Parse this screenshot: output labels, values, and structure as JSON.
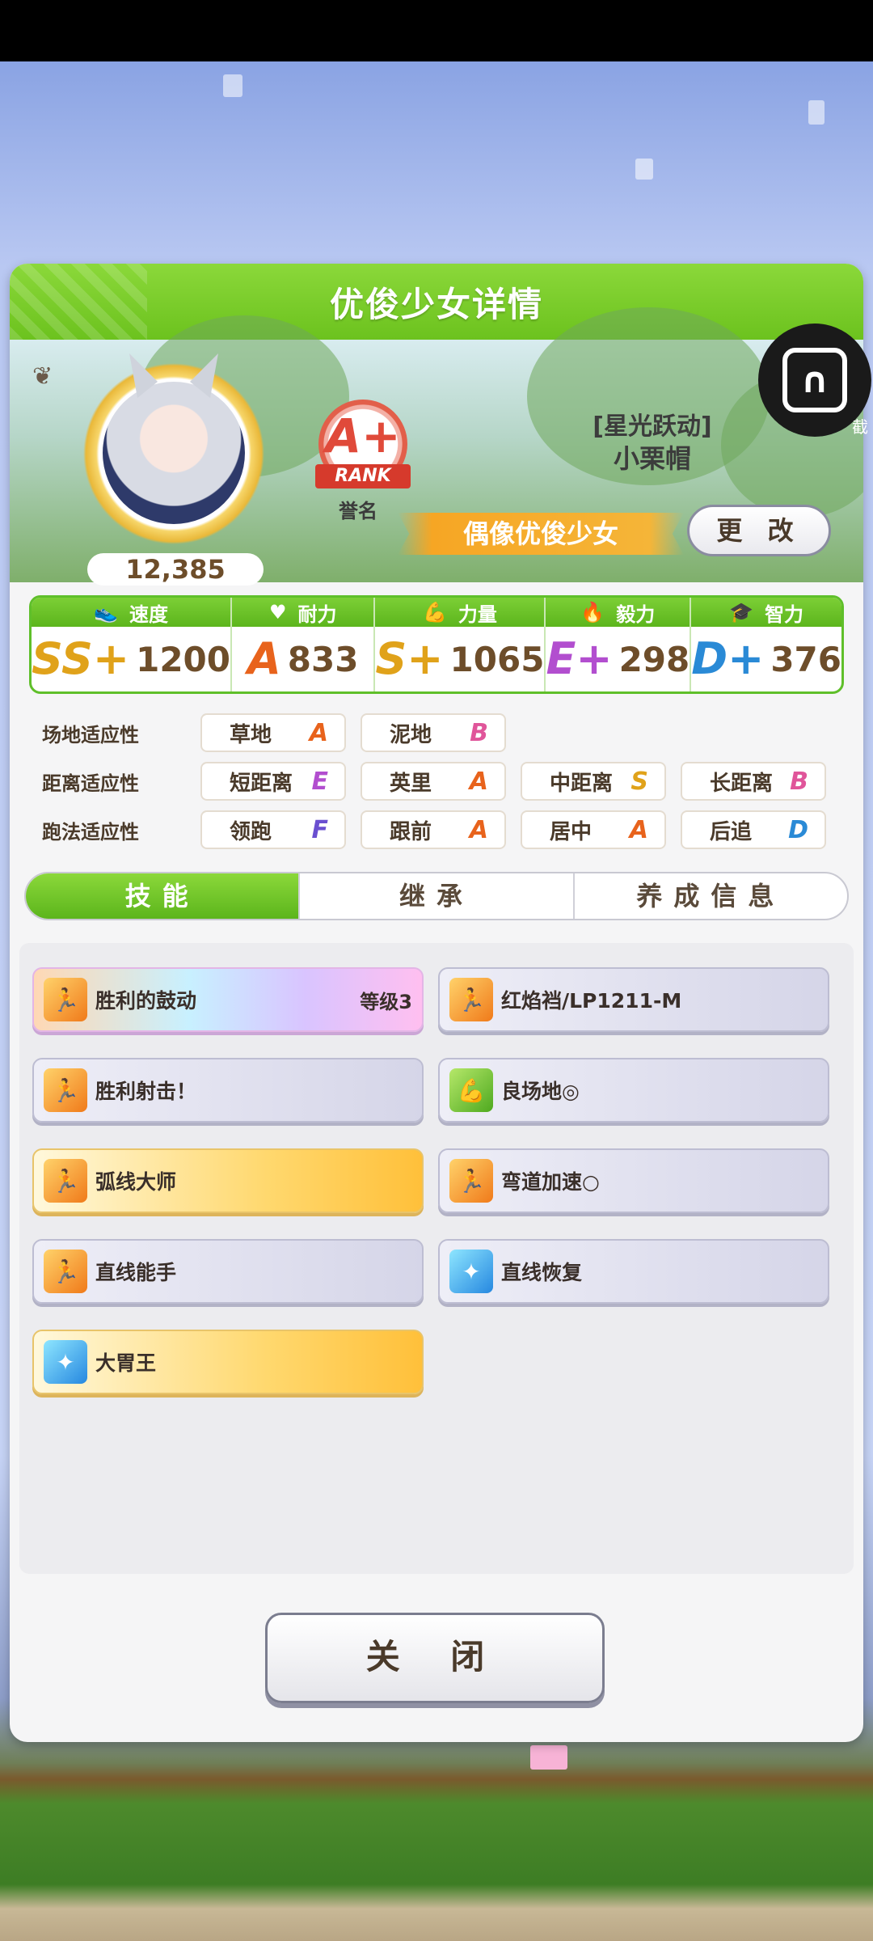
{
  "title": "优俊少女详情",
  "profile": {
    "score": "12,385",
    "rank_letter": "A+",
    "rank_label": "RANK",
    "honor_label": "誉名",
    "epithet": "[星光跃动]",
    "name": "小栗帽",
    "title_badge": "偶像优俊少女",
    "change_button": "更 改"
  },
  "stats": [
    {
      "label": "速度",
      "icon": "shoe-icon",
      "grade": "SS+",
      "grade_color": "#e0a21a",
      "value": "1200"
    },
    {
      "label": "耐力",
      "icon": "heart-icon",
      "grade": "A",
      "grade_color": "#e8631c",
      "value": "833"
    },
    {
      "label": "力量",
      "icon": "muscle-icon",
      "grade": "S+",
      "grade_color": "#e0a21a",
      "value": "1065"
    },
    {
      "label": "毅力",
      "icon": "flame-icon",
      "grade": "E+",
      "grade_color": "#b24ecf",
      "value": "298"
    },
    {
      "label": "智力",
      "icon": "graduation-cap-icon",
      "grade": "D+",
      "grade_color": "#2a8ad6",
      "value": "376"
    }
  ],
  "aptitude": {
    "track": {
      "label": "场地适应性",
      "items": [
        {
          "name": "草地",
          "grade": "A"
        },
        {
          "name": "泥地",
          "grade": "B"
        }
      ]
    },
    "distance": {
      "label": "距离适应性",
      "items": [
        {
          "name": "短距离",
          "grade": "E"
        },
        {
          "name": "英里",
          "grade": "A"
        },
        {
          "name": "中距离",
          "grade": "S"
        },
        {
          "name": "长距离",
          "grade": "B"
        }
      ]
    },
    "style": {
      "label": "跑法适应性",
      "items": [
        {
          "name": "领跑",
          "grade": "F"
        },
        {
          "name": "跟前",
          "grade": "A"
        },
        {
          "name": "居中",
          "grade": "A"
        },
        {
          "name": "后追",
          "grade": "D"
        }
      ]
    }
  },
  "grade_colors": {
    "A": "#e8631c",
    "B": "#e0559a",
    "E": "#b24ecf",
    "S": "#e0a21a",
    "F": "#6a4fd0",
    "D": "#2a8ad6"
  },
  "tabs": [
    "技能",
    "继承",
    "养成信息"
  ],
  "skills": [
    {
      "name": "胜利的鼓动",
      "level": "等级3",
      "style": "rainbow",
      "icon": "runner-icon"
    },
    {
      "name": "红焰裆/LP1211-M",
      "style": "plain",
      "icon": "runner-icon"
    },
    {
      "name": "胜利射击！",
      "style": "plain",
      "icon": "runner-icon"
    },
    {
      "name": "良场地◎",
      "style": "plain",
      "icon": "muscle-icon"
    },
    {
      "name": "弧线大师",
      "style": "gold",
      "icon": "runner-icon"
    },
    {
      "name": "弯道加速○",
      "style": "plain",
      "icon": "runner-icon"
    },
    {
      "name": "直线能手",
      "style": "plain",
      "icon": "runner-icon"
    },
    {
      "name": "直线恢复",
      "style": "plain",
      "icon": "sparkle-icon"
    },
    {
      "name": "大胃王",
      "style": "gold",
      "icon": "sparkle-icon"
    }
  ],
  "close_button": "关 闭",
  "overlay": {
    "label": "截"
  }
}
